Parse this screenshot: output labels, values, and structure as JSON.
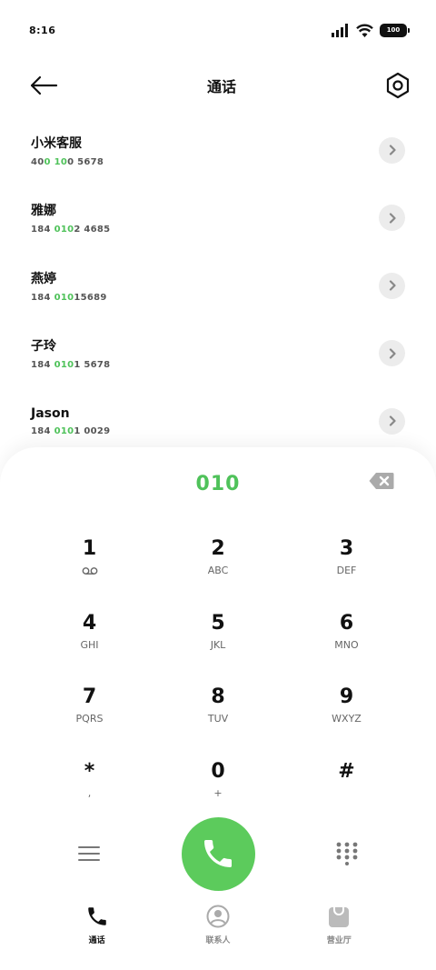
{
  "status": {
    "time": "8:16",
    "battery": "100"
  },
  "header": {
    "title": "通话"
  },
  "contacts": [
    {
      "name": "小米客服",
      "num_pre": "40",
      "num_hl": "0 10",
      "num_post": "0 5678"
    },
    {
      "name": "雅娜",
      "num_pre": "184 ",
      "num_hl": "010",
      "num_post": "2 4685"
    },
    {
      "name": "燕婷",
      "num_pre": "184 ",
      "num_hl": "010",
      "num_post": "15689"
    },
    {
      "name": "子玲",
      "num_pre": "184 ",
      "num_hl": "010",
      "num_post": "1 5678"
    },
    {
      "name": "Jason",
      "num_pre": "184 ",
      "num_hl": "010",
      "num_post": "1 0029"
    }
  ],
  "dialer": {
    "value": "010",
    "keys": [
      [
        {
          "digit": "1",
          "sub": ""
        },
        {
          "digit": "2",
          "sub": "ABC"
        },
        {
          "digit": "3",
          "sub": "DEF"
        }
      ],
      [
        {
          "digit": "4",
          "sub": "GHI"
        },
        {
          "digit": "5",
          "sub": "JKL"
        },
        {
          "digit": "6",
          "sub": "MNO"
        }
      ],
      [
        {
          "digit": "7",
          "sub": "PQRS"
        },
        {
          "digit": "8",
          "sub": "TUV"
        },
        {
          "digit": "9",
          "sub": "WXYZ"
        }
      ],
      [
        {
          "digit": "*",
          "sub": ","
        },
        {
          "digit": "0",
          "sub": "+"
        },
        {
          "digit": "#",
          "sub": ""
        }
      ]
    ]
  },
  "nav": [
    {
      "label": "通话",
      "icon": "phone-icon",
      "active": true
    },
    {
      "label": "联系人",
      "icon": "person-icon",
      "active": false
    },
    {
      "label": "营业厅",
      "icon": "bag-icon",
      "active": false
    }
  ],
  "colors": {
    "accent": "#4fc25a",
    "call": "#5ccb5c"
  }
}
